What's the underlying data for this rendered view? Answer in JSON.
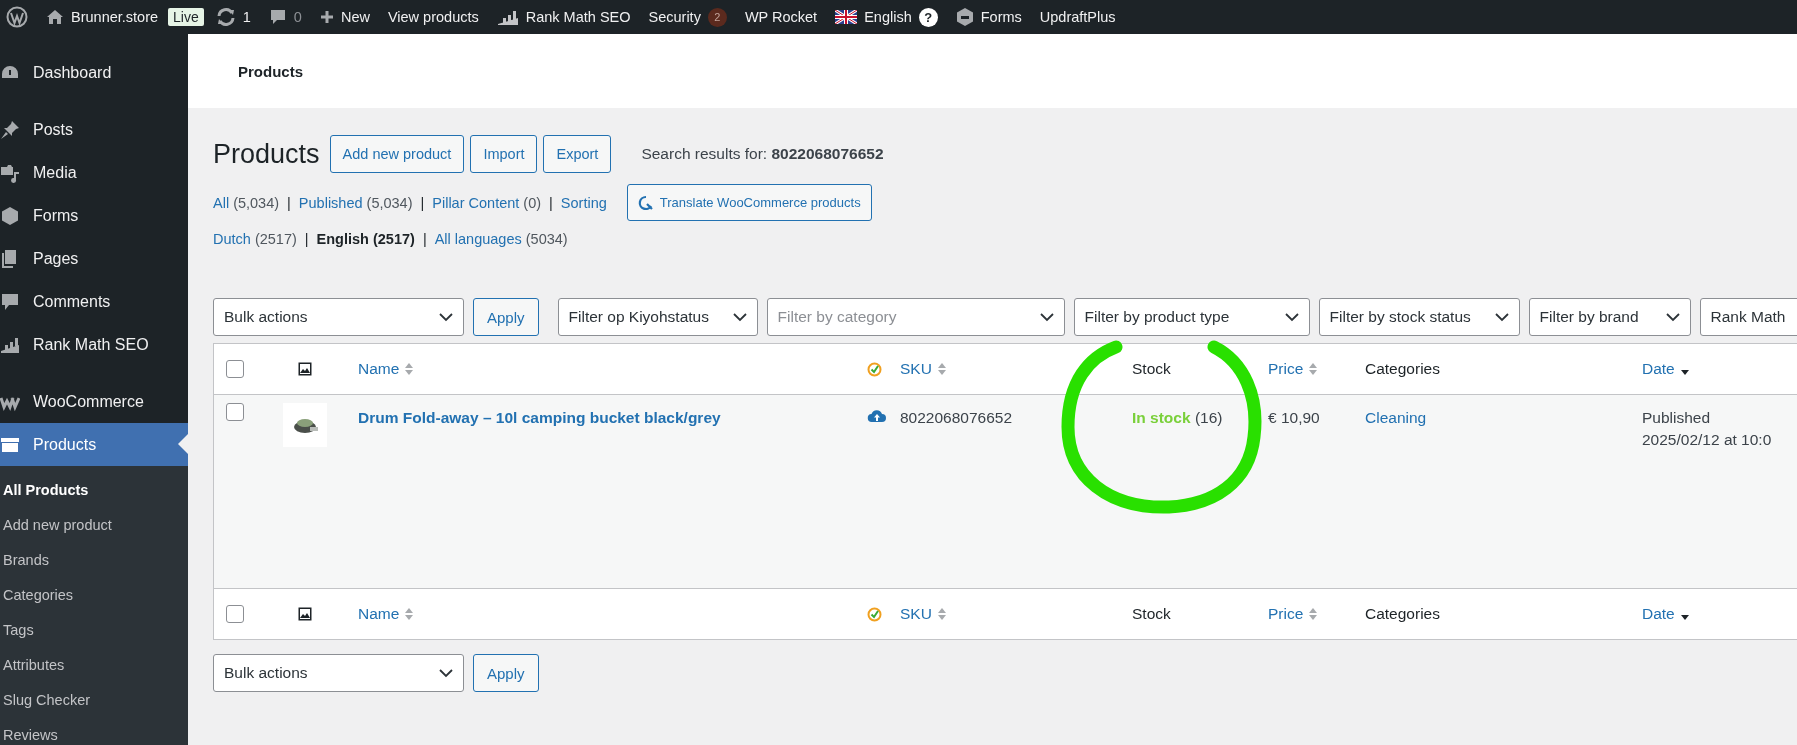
{
  "admin_bar": {
    "site": "Brunner.store",
    "live_badge": "Live",
    "updates": "1",
    "comments": "0",
    "new": "New",
    "view_products": "View products",
    "rank_math": "Rank Math SEO",
    "security": "Security",
    "security_count": "2",
    "wp_rocket": "WP Rocket",
    "language": "English",
    "help": "?",
    "forms": "Forms",
    "updraft": "UpdraftPlus"
  },
  "sidebar": {
    "groups": [
      [
        {
          "label": "Dashboard",
          "selected": false
        }
      ],
      [
        {
          "label": "Posts",
          "selected": false
        },
        {
          "label": "Media",
          "selected": false
        },
        {
          "label": "Forms",
          "selected": false
        },
        {
          "label": "Pages",
          "selected": false
        },
        {
          "label": "Comments",
          "selected": false
        },
        {
          "label": "Rank Math SEO",
          "selected": false
        }
      ],
      [
        {
          "label": "WooCommerce",
          "selected": false
        },
        {
          "label": "Products",
          "selected": true,
          "children": [
            {
              "label": "All Products",
              "selected": true
            },
            {
              "label": "Add new product",
              "selected": false
            },
            {
              "label": "Brands",
              "selected": false
            },
            {
              "label": "Categories",
              "selected": false
            },
            {
              "label": "Tags",
              "selected": false
            },
            {
              "label": "Attributes",
              "selected": false
            },
            {
              "label": "Slug Checker",
              "selected": false
            },
            {
              "label": "Reviews",
              "selected": false
            }
          ]
        }
      ]
    ]
  },
  "header_bar": {
    "title": "Products"
  },
  "page": {
    "title": "Products",
    "buttons": [
      "Add new product",
      "Import",
      "Export"
    ],
    "search_results": "Search results for: **8022068076652**",
    "views": [
      {
        "label": "All",
        "count": "(5,034)",
        "selected": false
      },
      {
        "separator": "|",
        "label": "Published",
        "count": "(5,034)",
        "selected": false
      },
      {
        "separator": "|",
        "label": "Pillar Content",
        "count": "(0)",
        "selected": false
      },
      {
        "separator": "|",
        "label": "Sorting",
        "selected": false
      }
    ],
    "translate_button": "Translate WooCommerce products",
    "languages": [
      {
        "label": "Dutch",
        "count": "(2517)",
        "selected": false
      },
      {
        "separator": "|",
        "label": "English",
        "count": "(2517)",
        "selected": true
      },
      {
        "separator": "|",
        "label": "All languages",
        "count": "(5034)",
        "selected": false
      }
    ]
  },
  "top_actions": {
    "bulk": "Bulk actions",
    "apply": "Apply",
    "filters": [
      {
        "label": "Filter op Kiyohstatus",
        "placeholder": false
      },
      {
        "label": "Filter by category",
        "placeholder": true
      },
      {
        "label": "Filter by product type",
        "placeholder": false
      },
      {
        "label": "Filter by stock status",
        "placeholder": false
      },
      {
        "label": "Filter by brand",
        "placeholder": false
      },
      {
        "label": "Rank Math",
        "placeholder": false
      }
    ]
  },
  "table": {
    "header": [
      {
        "kind": "checkbox",
        "checked": false
      },
      {
        "kind": "image"
      },
      {
        "kind": "text",
        "label": "Name",
        "sortable": true,
        "sorted": false
      },
      {
        "kind": "review"
      },
      {
        "kind": "text",
        "label": "SKU",
        "sortable": true,
        "sorted": false
      },
      {
        "kind": "text",
        "label": "Stock",
        "sortable": false
      },
      {
        "kind": "text",
        "label": "Price",
        "sortable": true,
        "sorted": false
      },
      {
        "kind": "text",
        "label": "Categories",
        "sortable": false
      },
      {
        "kind": "text",
        "label": "Date",
        "sortable": true,
        "sorted": true
      }
    ],
    "rows": [
      {
        "checked": false,
        "name": "Drum Fold-away – 10l camping bucket black/grey",
        "sku": "8022068076652",
        "stock_status": "In stock",
        "stock_count": "(16)",
        "price": "€ 10,90",
        "category": "Cleaning",
        "date_status": "Published",
        "date": "2025/02/12 at 10:0"
      }
    ],
    "footer": [
      {
        "kind": "checkbox",
        "checked": false
      },
      {
        "kind": "image"
      },
      {
        "kind": "text",
        "label": "Name",
        "sortable": true,
        "sorted": false
      },
      {
        "kind": "review"
      },
      {
        "kind": "text",
        "label": "SKU",
        "sortable": true,
        "sorted": false
      },
      {
        "kind": "text",
        "label": "Stock",
        "sortable": false
      },
      {
        "kind": "text",
        "label": "Price",
        "sortable": true,
        "sorted": false
      },
      {
        "kind": "text",
        "label": "Categories",
        "sortable": false
      },
      {
        "kind": "text",
        "label": "Date",
        "sortable": true,
        "sorted": true
      }
    ]
  },
  "bottom_actions": {
    "bulk": "Bulk actions",
    "apply": "Apply"
  }
}
